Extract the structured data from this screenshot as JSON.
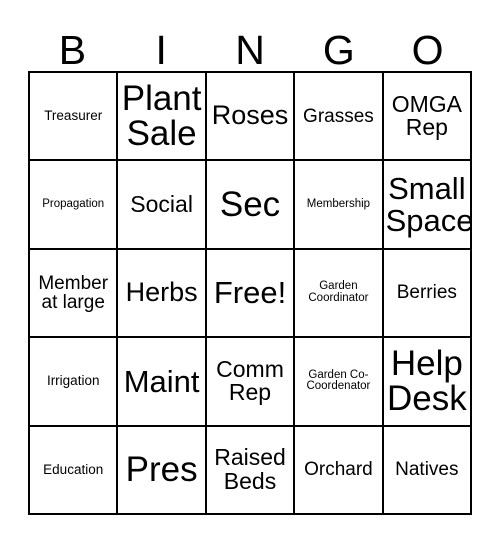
{
  "card": {
    "header_letters": [
      "B",
      "I",
      "N",
      "G",
      "O"
    ],
    "rows": [
      [
        {
          "text": "Treasurer",
          "size": "s"
        },
        {
          "text": "Plant Sale",
          "size": "3xl"
        },
        {
          "text": "Roses",
          "size": "xl"
        },
        {
          "text": "Grasses",
          "size": "m"
        },
        {
          "text": "OMGA Rep",
          "size": "l"
        }
      ],
      [
        {
          "text": "Propagation",
          "size": "xs"
        },
        {
          "text": "Social",
          "size": "l"
        },
        {
          "text": "Sec",
          "size": "3xl"
        },
        {
          "text": "Membership",
          "size": "xs"
        },
        {
          "text": "Small Space",
          "size": "xxl"
        }
      ],
      [
        {
          "text": "Member at large",
          "size": "m"
        },
        {
          "text": "Herbs",
          "size": "xl"
        },
        {
          "text": "Free!",
          "size": "xxl"
        },
        {
          "text": "Garden Coordinator",
          "size": "xs"
        },
        {
          "text": "Berries",
          "size": "m"
        }
      ],
      [
        {
          "text": "Irrigation",
          "size": "s"
        },
        {
          "text": "Maint",
          "size": "xxl"
        },
        {
          "text": "Comm Rep",
          "size": "l"
        },
        {
          "text": "Garden Co-Coordenator",
          "size": "xs"
        },
        {
          "text": "Help Desk",
          "size": "3xl"
        }
      ],
      [
        {
          "text": "Education",
          "size": "s"
        },
        {
          "text": "Pres",
          "size": "3xl"
        },
        {
          "text": "Raised Beds",
          "size": "l"
        },
        {
          "text": "Orchard",
          "size": "m"
        },
        {
          "text": "Natives",
          "size": "m"
        }
      ]
    ],
    "free_space": {
      "row": 2,
      "col": 2,
      "label": "Free!"
    },
    "colors": {
      "background": "#ffffff",
      "text": "#000000",
      "grid_line": "#000000"
    }
  }
}
